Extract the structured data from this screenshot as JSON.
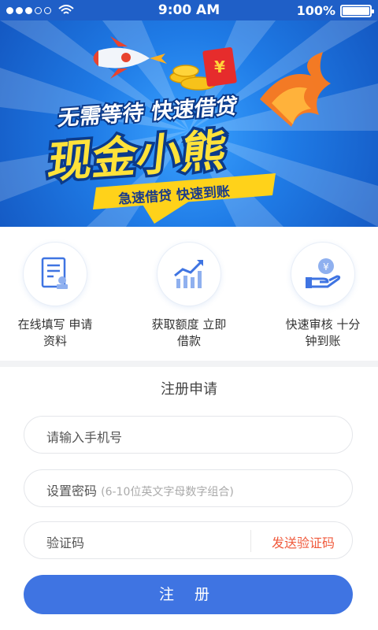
{
  "status_bar": {
    "time": "9:00 AM",
    "battery": "100%"
  },
  "banner": {
    "slogan": "无需等待 快速借贷",
    "brand": "现金小熊",
    "subtitle": "急速借贷  快速到账",
    "envelope_symbol": "¥"
  },
  "features": [
    {
      "line1": "在线填写 申请",
      "line2": "资料",
      "icon": "form-stamp-icon"
    },
    {
      "line1": "获取额度 立即",
      "line2": "借款",
      "icon": "growth-chart-icon"
    },
    {
      "line1": "快速审核 十分",
      "line2": "钟到账",
      "icon": "coin-hand-icon"
    }
  ],
  "form": {
    "title": "注册申请",
    "phone_placeholder": "请输入手机号",
    "password_label": "设置密码",
    "password_hint": "(6-10位英文字母数字组合)",
    "code_label": "验证码",
    "send_code": "发送验证码",
    "submit": "注 册"
  },
  "colors": {
    "primary": "#3f74e2",
    "accent": "#f05a3c",
    "status_bar": "#1f5fc7"
  }
}
